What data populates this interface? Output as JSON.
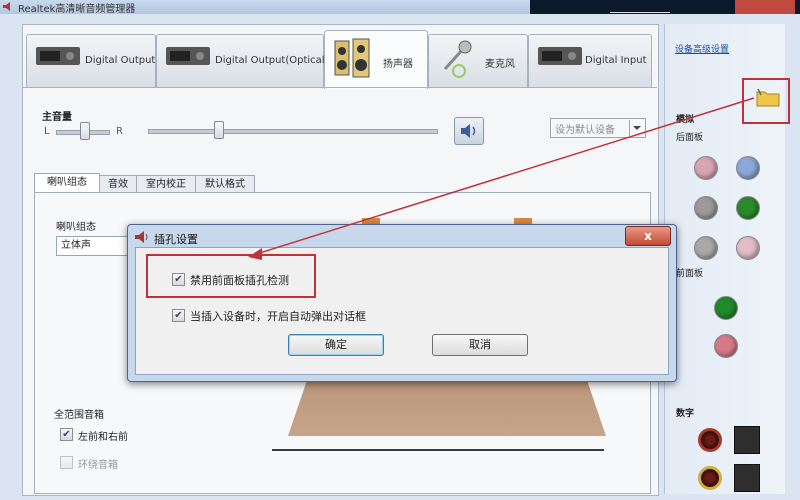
{
  "window": {
    "title": "Realtek高清晰音频管理器"
  },
  "device_tabs": [
    {
      "label": "Digital Output",
      "active": false
    },
    {
      "label": "Digital Output(Optical)",
      "active": false
    },
    {
      "label": "扬声器",
      "active": true
    },
    {
      "label": "麦克风",
      "active": false
    },
    {
      "label": "Digital Input",
      "active": false
    }
  ],
  "volume": {
    "label": "主音量",
    "left": "L",
    "right": "R",
    "default_device": "设为默认设备"
  },
  "sub_tabs": [
    "喇叭组态",
    "音效",
    "室内校正",
    "默认格式"
  ],
  "speaker_config": {
    "label": "喇叭组态",
    "value": "立体声"
  },
  "fullrange": {
    "label": "全范围音箱",
    "front": "左前和右前",
    "surround": "环绕音箱"
  },
  "dialog": {
    "title": "插孔设置",
    "close": "x",
    "opt1": "禁用前面板插孔检测",
    "opt2": "当插入设备时，开启自动弹出对话框",
    "ok": "确定",
    "cancel": "取消"
  },
  "right_panel": {
    "link": "设备高级设置",
    "analog": "模拟",
    "back_panel": "后面板",
    "front_panel": "前面板",
    "digital": "数字"
  },
  "colors": {
    "jack_pink": "#d8a6b2",
    "jack_blue": "#8aa8d8",
    "jack_gray": "#9a9a9a",
    "jack_green": "#2a8a2a",
    "highlight": "#c0323a"
  }
}
